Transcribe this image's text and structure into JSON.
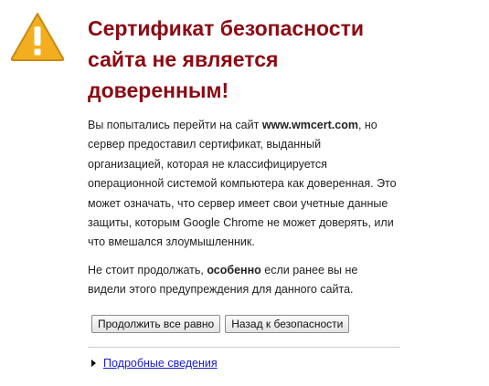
{
  "icon": {
    "name": "warning-icon",
    "fill_color": "#f2ae1f",
    "stroke_color": "#c98a12",
    "mark_color": "#ffffff"
  },
  "title": {
    "line1": "Сертификат безопасности",
    "line2": "сайта не является",
    "line3": "доверенным!",
    "color": "#8b0a14"
  },
  "paragraph1": {
    "text_before": "Вы попытались перейти на сайт ",
    "site": "www.wmcert.com",
    "text_after": ", но сервер предоставил сертификат, выданный организацией, которая не классифицируется операционной системой компьютера как доверенная. Это может означать, что сервер имеет свои учетные данные защиты, которым Google Chrome не может доверять, или что вмешался злоумышленник."
  },
  "paragraph2": {
    "text_before": "Не стоит продолжать, ",
    "emphasis": "особенно",
    "text_after": " если ранее вы не видели этого предупреждения для данного сайта."
  },
  "buttons": {
    "proceed_label": "Продолжить все равно",
    "back_label": "Назад к безопасности"
  },
  "details": {
    "link_label": "Подробные сведения",
    "link_color": "#1a1acc"
  }
}
